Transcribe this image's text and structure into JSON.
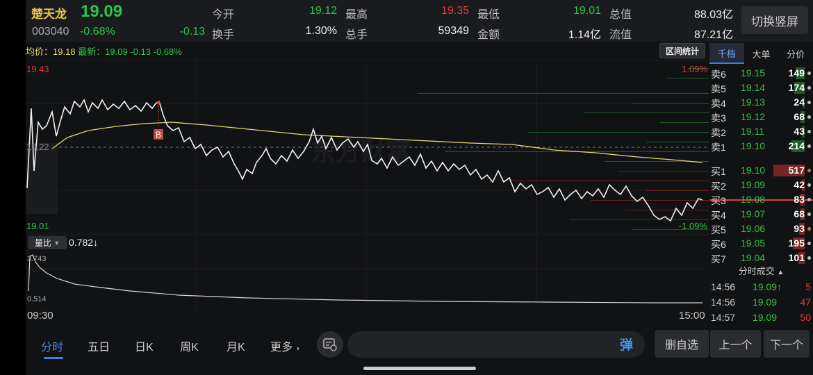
{
  "header": {
    "name": "楚天龙",
    "price": "19.09",
    "code": "003040",
    "pct": "-0.68%",
    "chg": "-0.13",
    "open_label": "今开",
    "open_val": "19.12",
    "high_label": "最高",
    "high_val": "19.35",
    "low_label": "最低",
    "low_val": "19.01",
    "total_label": "总值",
    "total_val": "88.03亿",
    "turnover_label": "换手",
    "turnover_val": "1.30%",
    "hands_label": "总手",
    "hands_val": "59349",
    "amount_label": "金额",
    "amount_val": "1.14亿",
    "float_label": "流值",
    "float_val": "87.21亿",
    "switch_button": "切换竖屏"
  },
  "info_line": {
    "avg": "均价：19.18",
    "latest": "最新：19.09",
    "chg": "-0.13",
    "pct": "-0.68%",
    "range_button": "区间统计"
  },
  "chart": {
    "y_high": "19.43",
    "y_mid": "19.22",
    "y_low": "19.01",
    "pct_high": "1.09%",
    "pct_low": "-1.09%",
    "buy_marker": "B",
    "watermark": "东方财富"
  },
  "volume": {
    "badge": "量比",
    "value": "0.782↓",
    "y_high": "3.743",
    "y_low": "0.514"
  },
  "time_axis": {
    "start": "09:30",
    "end": "15:00"
  },
  "panel": {
    "tabs": [
      "千档",
      "大单",
      "分价"
    ],
    "asks": [
      {
        "label": "卖6",
        "price": "19.15",
        "vol": "149"
      },
      {
        "label": "卖5",
        "price": "19.14",
        "vol": "174"
      },
      {
        "label": "卖4",
        "price": "19.13",
        "vol": "24"
      },
      {
        "label": "卖3",
        "price": "19.12",
        "vol": "68"
      },
      {
        "label": "卖2",
        "price": "19.11",
        "vol": "43"
      },
      {
        "label": "卖1",
        "price": "19.10",
        "vol": "214"
      }
    ],
    "bids": [
      {
        "label": "买1",
        "price": "19.10",
        "vol": "517"
      },
      {
        "label": "买2",
        "price": "19.09",
        "vol": "42"
      },
      {
        "label": "买3",
        "price": "19.08",
        "vol": "83"
      },
      {
        "label": "买4",
        "price": "19.07",
        "vol": "68"
      },
      {
        "label": "买5",
        "price": "19.06",
        "vol": "93"
      },
      {
        "label": "买6",
        "price": "19.05",
        "vol": "195"
      },
      {
        "label": "买7",
        "price": "19.04",
        "vol": "101"
      }
    ],
    "trades_title": "分时成交",
    "trades": [
      {
        "time": "14:56",
        "price": "19.09↑",
        "vol": "5"
      },
      {
        "time": "14:56",
        "price": "19.09",
        "vol": "47"
      },
      {
        "time": "14:57",
        "price": "19.09",
        "vol": "50"
      }
    ]
  },
  "bottom": {
    "tabs": [
      "分时",
      "五日",
      "日K",
      "周K",
      "月K",
      "更多"
    ],
    "bomb_label": "弹",
    "remove_watchlist": "删自选",
    "prev": "上一个",
    "next": "下一个"
  },
  "colors": {
    "up": "#e23b3b",
    "down": "#2fc34a",
    "avg_line": "#e8d67a",
    "accent": "#3b7df0"
  }
}
